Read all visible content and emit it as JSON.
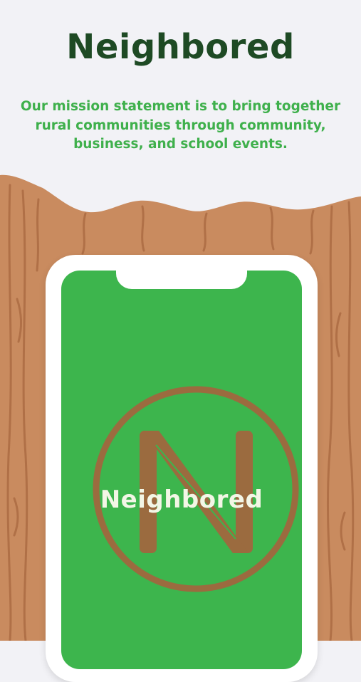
{
  "header": {
    "title": "Neighbored",
    "mission": "Our mission statement is to bring together rural communities through community, business, and school events."
  },
  "phone": {
    "logo_text": "Neighbored"
  },
  "colors": {
    "title": "#1e4a24",
    "mission_text": "#3fb04c",
    "screen_green": "#3db54d",
    "logo_brown": "#9b6b3f",
    "wood": "#c98b5f"
  }
}
